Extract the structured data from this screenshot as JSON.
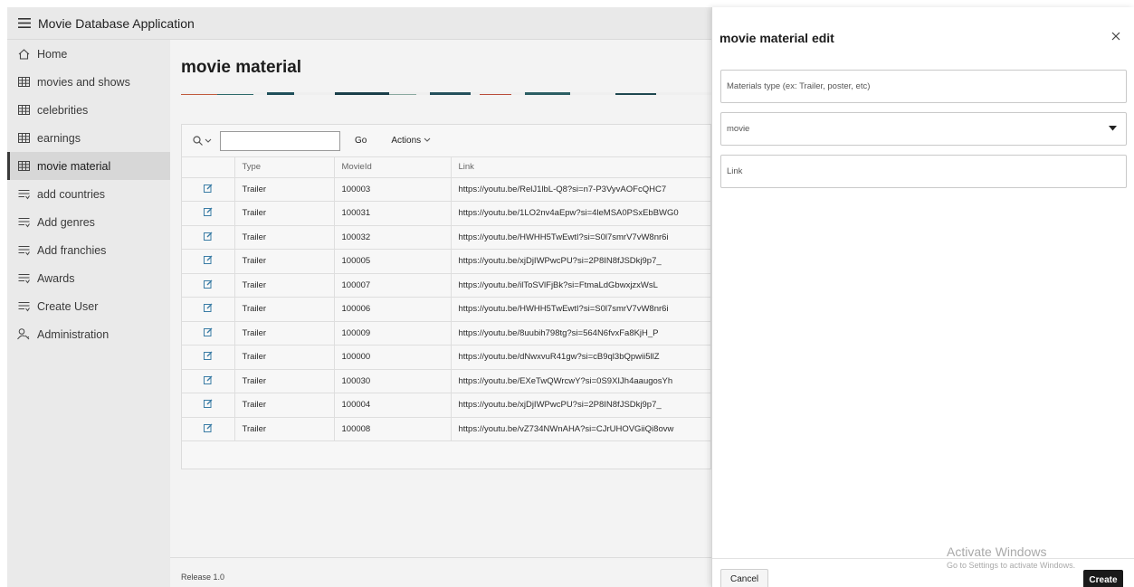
{
  "app": {
    "title": "Movie Database Application"
  },
  "sidebar": {
    "items": [
      {
        "label": "Home",
        "icon": "home-icon",
        "active": false
      },
      {
        "label": "movies and shows",
        "icon": "table-icon",
        "active": false
      },
      {
        "label": "celebrities",
        "icon": "table-icon",
        "active": false
      },
      {
        "label": "earnings",
        "icon": "table-icon",
        "active": false
      },
      {
        "label": "movie material",
        "icon": "table-icon",
        "active": true
      },
      {
        "label": "add countries",
        "icon": "form-icon",
        "active": false
      },
      {
        "label": "Add genres",
        "icon": "form-icon",
        "active": false
      },
      {
        "label": "Add franchies",
        "icon": "form-icon",
        "active": false
      },
      {
        "label": "Awards",
        "icon": "form-icon",
        "active": false
      },
      {
        "label": "Create User",
        "icon": "form-icon",
        "active": false
      },
      {
        "label": "Administration",
        "icon": "user-key-icon",
        "active": false
      }
    ]
  },
  "main": {
    "title": "movie material",
    "toolbar": {
      "search_value": "",
      "go_label": "Go",
      "actions_label": "Actions"
    },
    "columns": [
      "",
      "Type",
      "MovieId",
      "Link"
    ],
    "rows": [
      {
        "type": "Trailer",
        "movie_id": "100003",
        "link": "https://youtu.be/RelJ1lbL-Q8?si=n7-P3VyvAOFcQHC7"
      },
      {
        "type": "Trailer",
        "movie_id": "100031",
        "link": "https://youtu.be/1LO2nv4aEpw?si=4leMSA0PSxEbBWG0"
      },
      {
        "type": "Trailer",
        "movie_id": "100032",
        "link": "https://youtu.be/HWHH5TwEwtI?si=S0l7smrV7vW8nr6i"
      },
      {
        "type": "Trailer",
        "movie_id": "100005",
        "link": "https://youtu.be/xjDjIWPwcPU?si=2P8IN8fJSDkj9p7_"
      },
      {
        "type": "Trailer",
        "movie_id": "100007",
        "link": "https://youtu.be/ilToSVlFjBk?si=FtmaLdGbwxjzxWsL"
      },
      {
        "type": "Trailer",
        "movie_id": "100006",
        "link": "https://youtu.be/HWHH5TwEwtI?si=S0l7smrV7vW8nr6i"
      },
      {
        "type": "Trailer",
        "movie_id": "100009",
        "link": "https://youtu.be/8uubih798tg?si=564N6fvxFa8KjH_P"
      },
      {
        "type": "Trailer",
        "movie_id": "100000",
        "link": "https://youtu.be/dNwxvuR41gw?si=cB9ql3bQpwii5llZ"
      },
      {
        "type": "Trailer",
        "movie_id": "100030",
        "link": "https://youtu.be/EXeTwQWrcwY?si=0S9XIJh4aaugosYh"
      },
      {
        "type": "Trailer",
        "movie_id": "100004",
        "link": "https://youtu.be/xjDjIWPwcPU?si=2P8IN8fJSDkj9p7_"
      },
      {
        "type": "Trailer",
        "movie_id": "100008",
        "link": "https://youtu.be/vZ734NWnAHA?si=CJrUHOVGiiQi8ovw"
      }
    ],
    "release": "Release 1.0"
  },
  "drawer": {
    "title": "movie material edit",
    "fields": {
      "materials_type_placeholder": "Materials type (ex: Trailer, poster, etc)",
      "movie_value": "movie",
      "link_placeholder": "Link"
    },
    "cancel_label": "Cancel",
    "create_label": "Create"
  },
  "watermark": {
    "line1": "Activate Windows",
    "line2": "Go to Settings to activate Windows."
  },
  "colors": {
    "accent": "#1a1a1a",
    "sidebar_bg": "#eaeaea",
    "active_bg": "#d7d7d7",
    "main_bg": "#f3f3f3"
  }
}
